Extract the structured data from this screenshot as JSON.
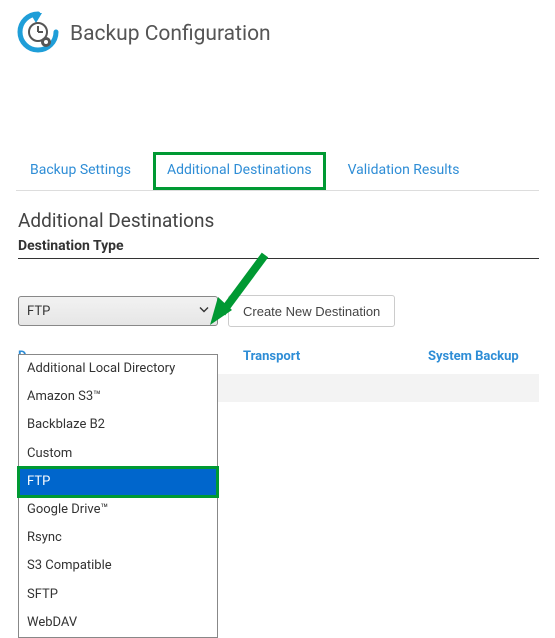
{
  "header": {
    "title": "Backup Configuration"
  },
  "tabs": {
    "items": [
      {
        "label": "Backup Settings"
      },
      {
        "label": "Additional Destinations"
      },
      {
        "label": "Validation Results"
      }
    ]
  },
  "section": {
    "heading": "Additional Destinations",
    "field_label": "Destination Type"
  },
  "select": {
    "value": "FTP"
  },
  "buttons": {
    "create": "Create New Destination"
  },
  "dropdown": {
    "options": [
      "Additional Local Directory",
      "Amazon S3™",
      "Backblaze B2",
      "Custom",
      "FTP",
      "Google Drive™",
      "Rsync",
      "S3 Compatible",
      "SFTP",
      "WebDAV"
    ]
  },
  "columns": {
    "a": "D",
    "b": "Transport",
    "c": "System Backup"
  }
}
